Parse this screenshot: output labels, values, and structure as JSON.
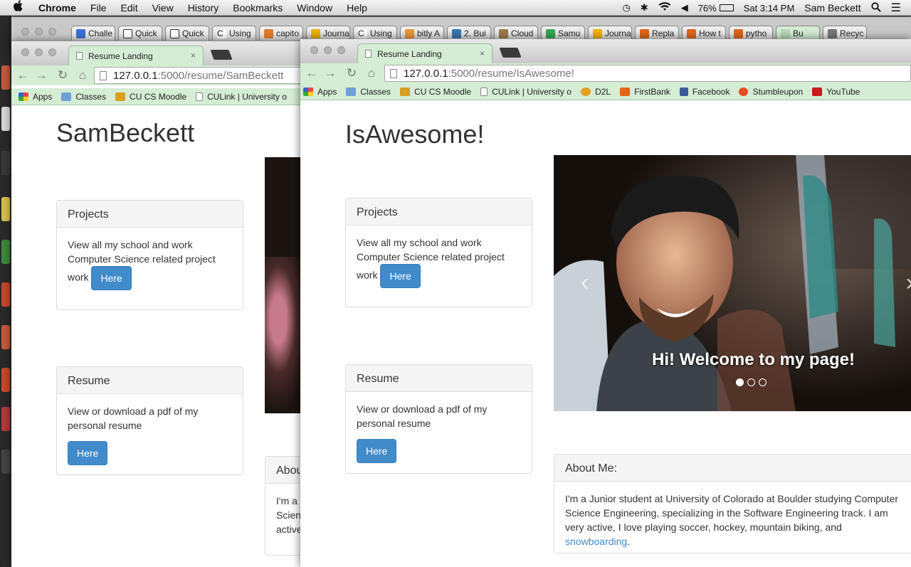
{
  "menubar": {
    "apple": "",
    "app_name": "Chrome",
    "menus": [
      "File",
      "Edit",
      "View",
      "History",
      "Bookmarks",
      "Window",
      "Help"
    ],
    "battery": "76%",
    "clock": "Sat 3:14 PM",
    "user": "Sam Beckett"
  },
  "top_tabs": [
    "Challe",
    "Quick",
    "Quick",
    "Using",
    "capito",
    "Journa",
    "Using",
    "bitly A",
    "2. Bui",
    "Cloud",
    "Samu",
    "Journa",
    "Repla",
    "How t",
    "pytho",
    "Bu",
    "Recyc"
  ],
  "back_window": {
    "tab_title": "Resume Landing",
    "tab_close": "×",
    "url_host": "127.0.0.1",
    "url_rest": ":5000/resume/SamBeckett",
    "bookmarks": [
      "Apps",
      "Classes",
      "CU CS Moodle",
      "CULink | University o"
    ],
    "heading": "SamBeckett",
    "projects": {
      "title": "Projects",
      "text": "View all my school and work Computer Science related project work",
      "button": "Here"
    },
    "resume": {
      "title": "Resume",
      "text": "View or download a pdf of my personal resume",
      "button": "Here"
    },
    "about_partial": {
      "title": "Abou",
      "line1": "I'm a",
      "line2": "Scien",
      "line3": "active"
    }
  },
  "front_window": {
    "tab_title": "Resume Landing",
    "tab_close": "×",
    "url_host": "127.0.0.1",
    "url_rest": ":5000/resume/IsAwesome!",
    "bookmarks": [
      "Apps",
      "Classes",
      "CU CS Moodle",
      "CULink | University o",
      "D2L",
      "FirstBank",
      "Facebook",
      "Stumbleupon",
      "YouTube"
    ],
    "heading": "IsAwesome!",
    "projects": {
      "title": "Projects",
      "text": "View all my school and work Computer Science related project work",
      "button": "Here"
    },
    "resume": {
      "title": "Resume",
      "text": "View or download a pdf of my personal resume",
      "button": "Here"
    },
    "carousel": {
      "caption": "Hi! Welcome to my page!",
      "active_slide": 1,
      "slide_count": 3,
      "prev": "‹",
      "next": "›"
    },
    "about": {
      "title": "About Me:",
      "text_before": "I'm a Junior student at University of Colorado at Boulder studying Computer Science Engineering, specializing in the Software Engineering track. I am very active, I love playing soccer, hockey, mountain biking, and ",
      "link": "snowboarding",
      "text_after": "."
    }
  },
  "colors": {
    "brand_blue": "#428bca",
    "chrome_green": "#d5ecd5"
  }
}
